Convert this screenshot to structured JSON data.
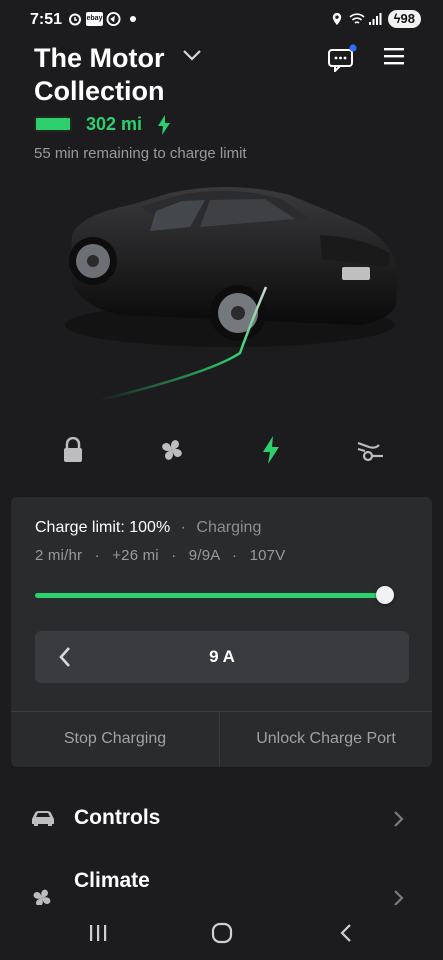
{
  "status_bar": {
    "time": "7:51",
    "battery_percent": "98",
    "icons": [
      "alarm-icon",
      "ebay-icon",
      "app-icon",
      "notification-dot",
      "location-icon",
      "wifi-icon",
      "signal-icon"
    ],
    "ebay_label": "ebay"
  },
  "header": {
    "title": "The Motor Collection",
    "range": "302 mi",
    "battery_level_fraction": 1.0,
    "charge_time_text": "55 min remaining to charge limit"
  },
  "quick_actions": [
    {
      "name": "lock-icon",
      "active": false
    },
    {
      "name": "fan-icon",
      "active": false
    },
    {
      "name": "charging-bolt-icon",
      "active": true
    },
    {
      "name": "charge-port-icon",
      "active": false
    }
  ],
  "charging": {
    "charge_limit_label": "Charge limit: 100%",
    "status": "Charging",
    "separator": "·",
    "rate": "2 mi/hr",
    "added": "+26 mi",
    "current": "9/9A",
    "voltage": "107V",
    "limit_fraction": 1.0,
    "amps": "9 A",
    "stop_button": "Stop Charging",
    "unlock_button": "Unlock Charge Port"
  },
  "list": [
    {
      "label": "Controls",
      "icon": "car-icon"
    },
    {
      "label": "Climate",
      "icon": "fan-icon"
    }
  ],
  "colors": {
    "accent": "#2ed06e",
    "background": "#1c1c1e",
    "card": "#2a2b2d",
    "notification": "#2f6bff"
  }
}
